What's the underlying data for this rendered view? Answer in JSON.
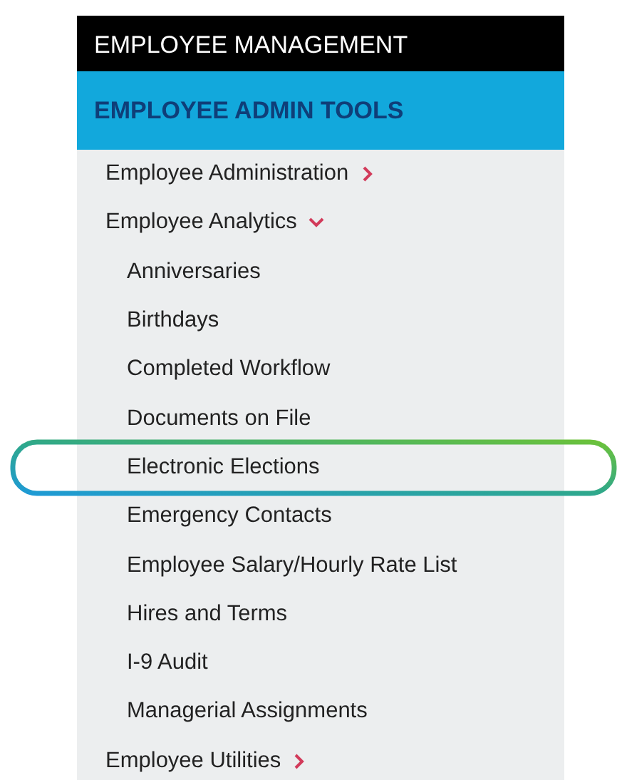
{
  "header": {
    "title": "EMPLOYEE MANAGEMENT"
  },
  "section": {
    "title": "EMPLOYEE ADMIN TOOLS"
  },
  "menu": [
    {
      "label": "Employee Administration",
      "expanded": false
    },
    {
      "label": "Employee Analytics",
      "expanded": true,
      "children": [
        {
          "label": "Anniversaries",
          "highlighted": false
        },
        {
          "label": "Birthdays",
          "highlighted": false
        },
        {
          "label": "Completed Workflow",
          "highlighted": false
        },
        {
          "label": "Documents on File",
          "highlighted": false
        },
        {
          "label": "Electronic Elections",
          "highlighted": true
        },
        {
          "label": "Emergency Contacts",
          "highlighted": false
        },
        {
          "label": "Employee Salary/Hourly Rate List",
          "highlighted": false
        },
        {
          "label": "Hires and Terms",
          "highlighted": false
        },
        {
          "label": "I-9 Audit",
          "highlighted": false
        },
        {
          "label": "Managerial Assignments",
          "highlighted": false
        }
      ]
    },
    {
      "label": "Employee Utilities",
      "expanded": false
    }
  ]
}
